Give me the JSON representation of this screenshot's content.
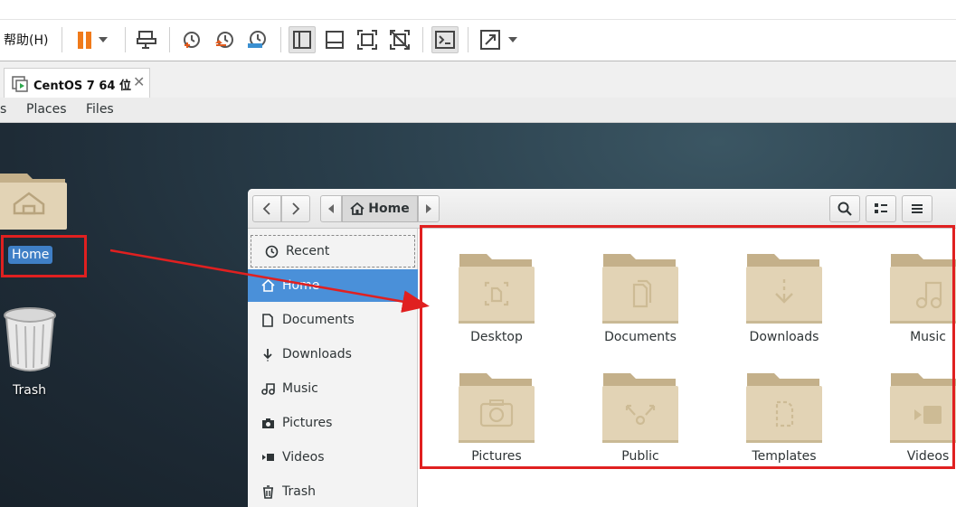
{
  "vm_toolbar": {
    "help_menu": "帮助(H)"
  },
  "tab": {
    "label": "CentOS 7 64 位",
    "close": "✕"
  },
  "gnome_bar": {
    "applications_partial": "s",
    "places": "Places",
    "files": "Files"
  },
  "desktop": {
    "home_label": "Home",
    "trash_label": "Trash"
  },
  "nautilus": {
    "path_label": "Home",
    "sidebar": [
      {
        "label": "Recent",
        "icon": "clock-icon"
      },
      {
        "label": "Home",
        "icon": "home-icon"
      },
      {
        "label": "Documents",
        "icon": "document-icon"
      },
      {
        "label": "Downloads",
        "icon": "download-icon"
      },
      {
        "label": "Music",
        "icon": "music-icon"
      },
      {
        "label": "Pictures",
        "icon": "camera-icon"
      },
      {
        "label": "Videos",
        "icon": "video-icon"
      },
      {
        "label": "Trash",
        "icon": "trash-icon"
      }
    ],
    "folders": [
      {
        "label": "Desktop",
        "emblem": "desktop"
      },
      {
        "label": "Documents",
        "emblem": "documents"
      },
      {
        "label": "Downloads",
        "emblem": "downloads"
      },
      {
        "label": "Music",
        "emblem": "music"
      },
      {
        "label": "Pictures",
        "emblem": "pictures"
      },
      {
        "label": "Public",
        "emblem": "public"
      },
      {
        "label": "Templates",
        "emblem": "templates"
      },
      {
        "label": "Videos",
        "emblem": "videos"
      }
    ]
  },
  "colors": {
    "selection": "#4a90d9",
    "annotation": "#e02020",
    "folder": "#e2d3b5"
  }
}
